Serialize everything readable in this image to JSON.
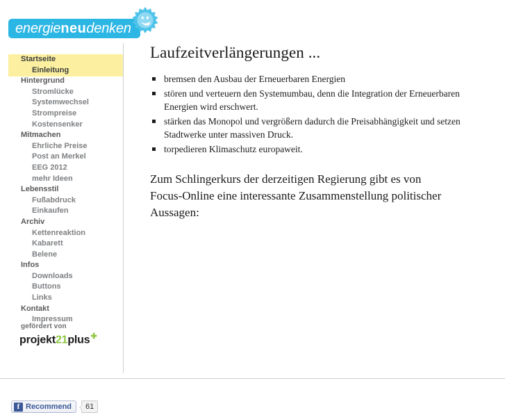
{
  "site": {
    "logo": {
      "part1": "energie",
      "part2": "neu",
      "part3": "denken",
      "badge_icon": "sun-smiley-icon",
      "brand_color": "#2cb6e4"
    }
  },
  "sidebar": {
    "highlight_color": "#fcf0a0",
    "items": [
      {
        "label": "Startseite",
        "level": 1,
        "active": true
      },
      {
        "label": "Einleitung",
        "level": 2,
        "active": true
      },
      {
        "label": "Hintergrund",
        "level": 1,
        "active": false
      },
      {
        "label": "Stromlücke",
        "level": 2,
        "active": false
      },
      {
        "label": "Systemwechsel",
        "level": 2,
        "active": false
      },
      {
        "label": "Strompreise",
        "level": 2,
        "active": false
      },
      {
        "label": "Kostensenker",
        "level": 2,
        "active": false
      },
      {
        "label": "Mitmachen",
        "level": 1,
        "active": false
      },
      {
        "label": "Ehrliche Preise",
        "level": 2,
        "active": false
      },
      {
        "label": "Post an Merkel",
        "level": 2,
        "active": false
      },
      {
        "label": "EEG 2012",
        "level": 2,
        "active": false
      },
      {
        "label": "mehr Ideen",
        "level": 2,
        "active": false
      },
      {
        "label": "Lebensstil",
        "level": 1,
        "active": false
      },
      {
        "label": "Fußabdruck",
        "level": 2,
        "active": false
      },
      {
        "label": "Einkaufen",
        "level": 2,
        "active": false
      },
      {
        "label": "Archiv",
        "level": 1,
        "active": false
      },
      {
        "label": "Kettenreaktion",
        "level": 2,
        "active": false
      },
      {
        "label": "Kabarett",
        "level": 2,
        "active": false
      },
      {
        "label": "Belene",
        "level": 2,
        "active": false
      },
      {
        "label": "Infos",
        "level": 1,
        "active": false
      },
      {
        "label": "Downloads",
        "level": 2,
        "active": false
      },
      {
        "label": "Buttons",
        "level": 2,
        "active": false
      },
      {
        "label": "Links",
        "level": 2,
        "active": false
      },
      {
        "label": "Kontakt",
        "level": 1,
        "active": false
      },
      {
        "label": "Impressum",
        "level": 2,
        "active": false
      }
    ],
    "sponsor": {
      "intro": "gefördert von",
      "name_part1": "projekt",
      "name_part2": "21",
      "name_part3": "plus",
      "plus_icon": "circle-plus-icon",
      "accent_color": "#8cc63e"
    },
    "social": {
      "facebook_icon": "facebook-f-icon",
      "recommend_label": "Recommend",
      "count": "61",
      "brand_color": "#3b5998"
    }
  },
  "main": {
    "title": "Laufzeitverlängerungen ...",
    "bullets": [
      "bremsen den Ausbau der Erneuerbaren Energien",
      "stören und verteuern den Systemumbau, denn die Integration der Erneuerbaren Energien wird erschwert.",
      "stärken das Monopol und vergrößern dadurch die Preisabhängigkeit und setzen Stadtwerke unter massiven Druck.",
      "torpedieren Klimaschutz europaweit."
    ],
    "closing_paragraph": "Zum Schlingerkurs der derzeitigen Regierung gibt es von Focus-Online eine interessante Zusammenstellung politischer Aussagen:"
  }
}
